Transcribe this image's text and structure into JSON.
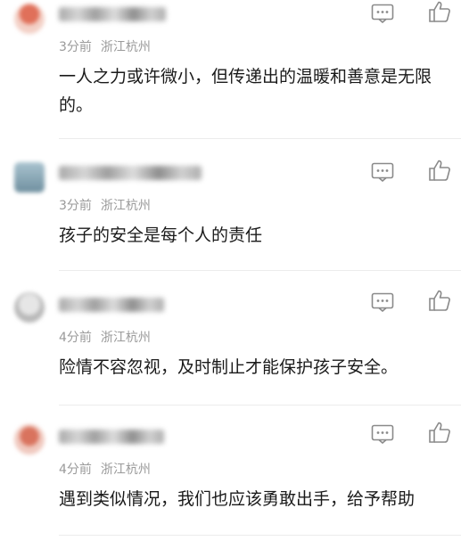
{
  "comments": [
    {
      "time": "3分前",
      "location": "浙江杭州",
      "text": "一人之力或许微小，但传递出的温暖和善意是无限的。",
      "avatar_color": "#e0705a"
    },
    {
      "time": "3分前",
      "location": "浙江杭州",
      "text": "孩子的安全是每个人的责任",
      "avatar_color": "#7f9fae"
    },
    {
      "time": "4分前",
      "location": "浙江杭州",
      "text": "险情不容忽视，及时制止才能保护孩子安全。",
      "avatar_color": "#c8c8c8"
    },
    {
      "time": "4分前",
      "location": "浙江杭州",
      "text": "遇到类似情况，我们也应该勇敢出手，给予帮助",
      "avatar_color": "#d9735e"
    }
  ],
  "icons": {
    "reply": "comment-reply-icon",
    "like": "thumbs-up-icon"
  },
  "colors": {
    "meta_text": "#9a9a9a",
    "body_text": "#1a1a1a",
    "icon_stroke": "#8a8a8a"
  }
}
